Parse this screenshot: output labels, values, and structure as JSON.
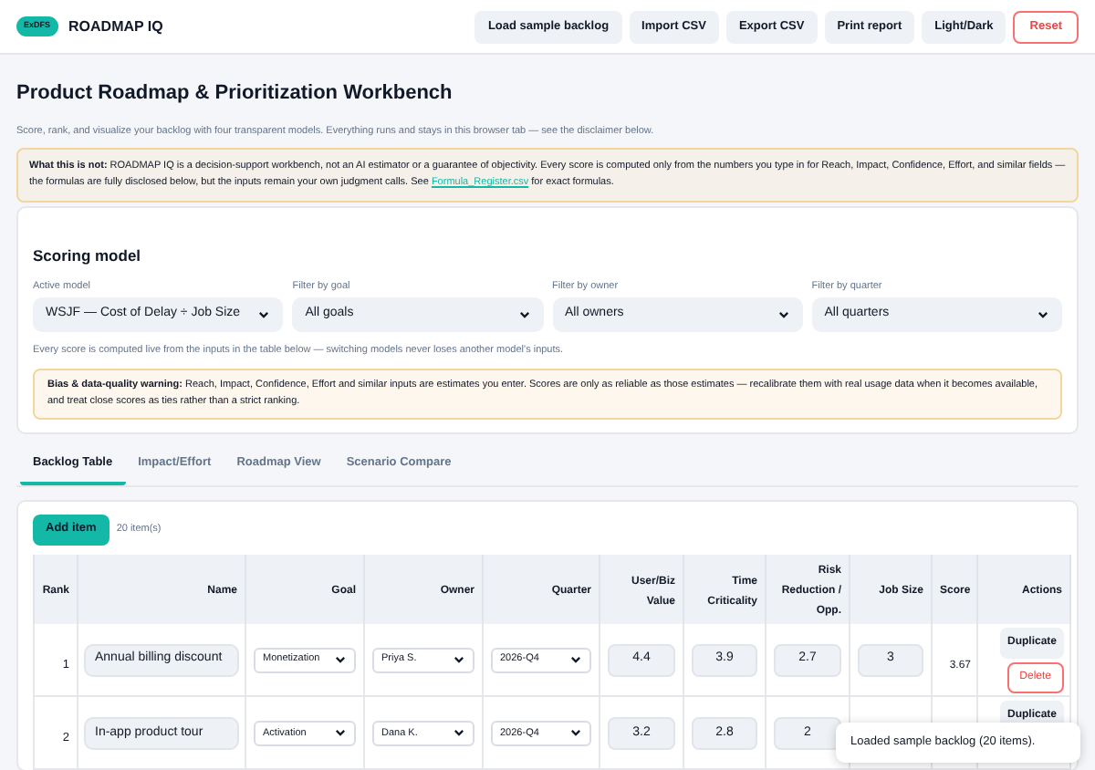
{
  "header": {
    "badge": "ExDFS",
    "title": "ROADMAP IQ",
    "buttons": [
      {
        "label": "Load sample backlog",
        "kind": "plain"
      },
      {
        "label": "Import CSV",
        "kind": "plain"
      },
      {
        "label": "Export CSV",
        "kind": "plain"
      },
      {
        "label": "Print report",
        "kind": "plain"
      },
      {
        "label": "Light/Dark",
        "kind": "plain"
      },
      {
        "label": "Reset",
        "kind": "danger"
      }
    ]
  },
  "page": {
    "title": "Product Roadmap & Prioritization Workbench",
    "subtitle": "Score, rank, and visualize your backlog with four transparent models. Everything runs and stays in this browser tab — see the disclaimer below.",
    "notice": "**What this is not:** ROADMAP IQ is a decision-support workbench, not an AI estimator or a guarantee of objectivity. Every score is computed only from the numbers you type in for Reach, Impact, Confidence, Effort, and similar fields — the formulas are fully disclosed below, but the inputs remain your own judgment calls. See",
    "notice_link": "Formula_Register.csv",
    "notice_end": "for exact formulas."
  },
  "scoring": {
    "title": "Scoring model",
    "filters": [
      {
        "label": "Active model",
        "value": "WSJF — Cost of Delay ÷ Job Size"
      },
      {
        "label": "Filter by goal",
        "value": "All goals"
      },
      {
        "label": "Filter by owner",
        "value": "All owners"
      },
      {
        "label": "Filter by quarter",
        "value": "All quarters"
      }
    ],
    "note": "Every score is computed live from the inputs in the table below — switching models never loses another model's inputs.",
    "warning": "**Bias & data-quality warning:** Reach, Impact, Confidence, Effort and similar inputs are estimates you enter. Scores are only as reliable as those estimates — recalibrate them with real usage data when it becomes available, and treat close scores as ties rather than a strict ranking."
  },
  "tabs": [
    {
      "label": "Backlog Table",
      "selected": true
    },
    {
      "label": "Impact/Effort",
      "selected": false
    },
    {
      "label": "Roadmap View",
      "selected": false
    },
    {
      "label": "Scenario Compare",
      "selected": false
    }
  ],
  "table": {
    "add_button": "Add item",
    "count": "20 item(s)",
    "columns": [
      "Rank",
      "Name",
      "Goal",
      "Owner",
      "Quarter",
      "User/Biz Value",
      "Time Criticality",
      "Risk Reduction / Opp.",
      "Job Size",
      "Score",
      "Actions"
    ],
    "rows": [
      {
        "rank": "1",
        "name": "Annual billing discount",
        "goal": "Monetization",
        "owner": "Priya S.",
        "quarter": "2026-Q4",
        "value": "4.4",
        "time": "3.9",
        "risk": "2.7",
        "job_size": "3",
        "score": "3.67",
        "duplicate": "Duplicate",
        "delete": "Delete"
      },
      {
        "rank": "2",
        "name": "In-app product tour",
        "goal": "Activation",
        "owner": "Dana K.",
        "quarter": "2026-Q4",
        "value": "3.2",
        "time": "2.8",
        "risk": "2",
        "duplicate": "Duplicate"
      }
    ]
  },
  "toast": "Loaded sample backlog (20 items)."
}
